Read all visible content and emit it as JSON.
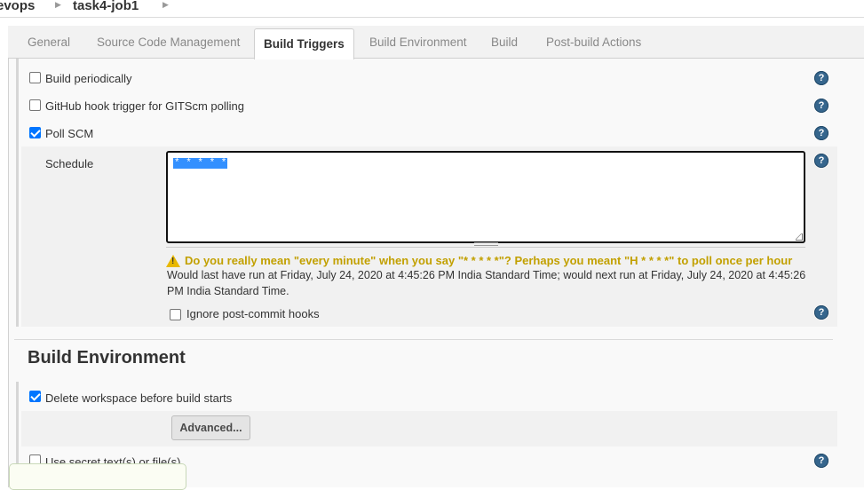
{
  "breadcrumb": {
    "items": [
      "evops",
      "task4-job1"
    ]
  },
  "tabs": [
    {
      "label": "General",
      "active": false
    },
    {
      "label": "Source Code Management",
      "active": false
    },
    {
      "label": "Build Triggers",
      "active": true
    },
    {
      "label": "Build Environment",
      "active": false
    },
    {
      "label": "Build",
      "active": false
    },
    {
      "label": "Post-build Actions",
      "active": false
    }
  ],
  "build_triggers": {
    "build_periodically": {
      "label": "Build periodically",
      "checked": false
    },
    "github_hook": {
      "label": "GitHub hook trigger for GITScm polling",
      "checked": false
    },
    "poll_scm": {
      "label": "Poll SCM",
      "checked": true
    },
    "schedule": {
      "label": "Schedule",
      "value": "* * * * *",
      "warning": "Do you really mean \"every minute\" when you say \"* * * * *\"? Perhaps you meant \"H * * * *\" to poll once per hour",
      "run_info": "Would last have run at Friday, July 24, 2020 at 4:45:26 PM India Standard Time; would next run at Friday, July 24, 2020 at 4:45:26 PM India Standard Time."
    },
    "ignore_post_commit": {
      "label": "Ignore post-commit hooks",
      "checked": false
    }
  },
  "build_environment": {
    "title": "Build Environment",
    "delete_workspace": {
      "label": "Delete workspace before build starts",
      "checked": true
    },
    "advanced_button": "Advanced...",
    "use_secret": {
      "label": "Use secret text(s) or file(s)",
      "checked": false
    }
  },
  "help_icon_glyph": "?",
  "colors": {
    "accent": "#0075ff",
    "help": "#36668d",
    "warning": "#c2a000",
    "selection": "#3390ff"
  }
}
